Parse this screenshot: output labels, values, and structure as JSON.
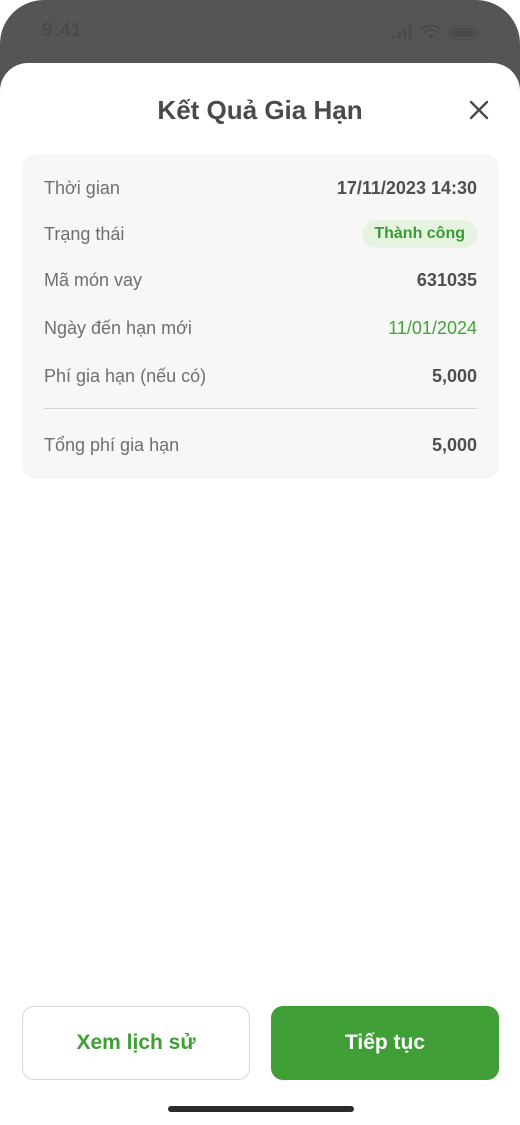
{
  "status_bar": {
    "time": "9:41"
  },
  "sheet": {
    "title": "Kết Quả Gia Hạn"
  },
  "details": {
    "rows": [
      {
        "label": "Thời gian",
        "value": "17/11/2023 14:30"
      },
      {
        "label": "Trạng thái",
        "value": "Thành công"
      },
      {
        "label": "Mã món vay",
        "value": "631035"
      },
      {
        "label": "Ngày đến hạn mới",
        "value": "11/01/2024"
      },
      {
        "label": "Phí gia hạn (nếu có)",
        "value": "5,000"
      }
    ],
    "total": {
      "label": "Tổng phí gia hạn",
      "value": "5,000"
    }
  },
  "actions": {
    "history_label": "Xem lịch sử",
    "continue_label": "Tiếp tục"
  },
  "colors": {
    "accent": "#3f9e36",
    "status_success_bg": "#e5f3e0",
    "overlay": "#555555"
  },
  "icons": {
    "signal": "signal-icon",
    "wifi": "wifi-icon",
    "battery": "battery-icon",
    "close": "close-icon"
  }
}
